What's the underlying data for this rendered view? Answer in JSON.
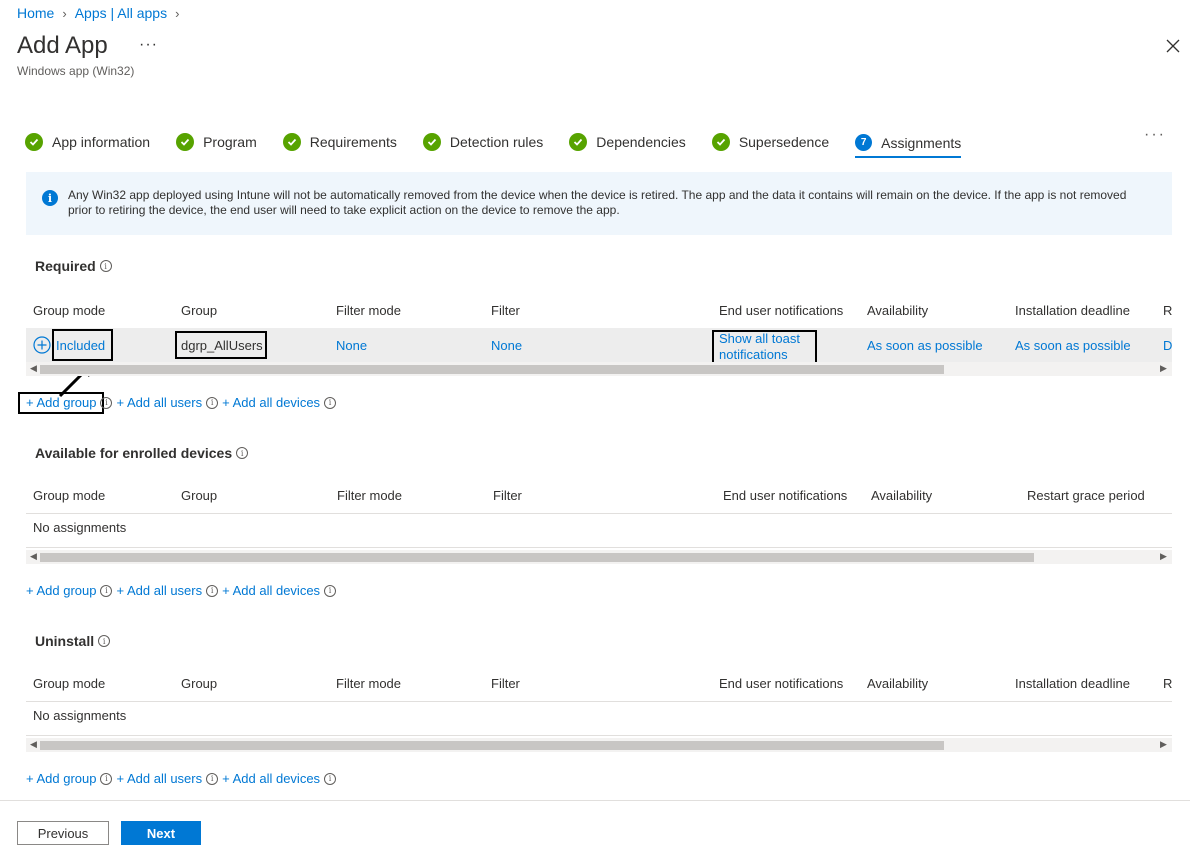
{
  "breadcrumb": {
    "home": "Home",
    "apps": "Apps | All apps"
  },
  "header": {
    "title": "Add App",
    "more": "···",
    "subtitle": "Windows app (Win32)"
  },
  "tabs": [
    {
      "label": "App information"
    },
    {
      "label": "Program"
    },
    {
      "label": "Requirements"
    },
    {
      "label": "Detection rules"
    },
    {
      "label": "Dependencies"
    },
    {
      "label": "Supersedence"
    },
    {
      "label": "Assignments",
      "step": "7"
    }
  ],
  "tabs_more": "···",
  "info_text": "Any Win32 app deployed using Intune will not be automatically removed from the device when the device is retired. The app and the data it contains will remain on the device. If the app is not removed prior to retiring the device, the end user will need to take explicit action on the device to remove the app.",
  "required": {
    "title": "Required",
    "columns": [
      "Group mode",
      "Group",
      "Filter mode",
      "Filter",
      "End user notifications",
      "Availability",
      "Installation deadline",
      "R"
    ],
    "row": {
      "group_mode": "Included",
      "group": "dgrp_AllUsers",
      "filter_mode": "None",
      "filter": "None",
      "notifications_line1": "Show all toast",
      "notifications_line2": "notifications",
      "availability": "As soon as possible",
      "deadline": "As soon as possible",
      "restart": "D"
    }
  },
  "available": {
    "title": "Available for enrolled devices",
    "columns": [
      "Group mode",
      "Group",
      "Filter mode",
      "Filter",
      "End user notifications",
      "Availability",
      "Restart grace period"
    ],
    "empty": "No assignments"
  },
  "uninstall": {
    "title": "Uninstall",
    "columns": [
      "Group mode",
      "Group",
      "Filter mode",
      "Filter",
      "End user notifications",
      "Availability",
      "Installation deadline",
      "R"
    ],
    "empty": "No assignments"
  },
  "actions": {
    "add_group": "+ Add group",
    "add_all_users": "+ Add all users",
    "add_all_devices": "+ Add all devices"
  },
  "footer": {
    "previous": "Previous",
    "next": "Next"
  },
  "colors": {
    "accent": "#0078d4",
    "success": "#57a300"
  }
}
